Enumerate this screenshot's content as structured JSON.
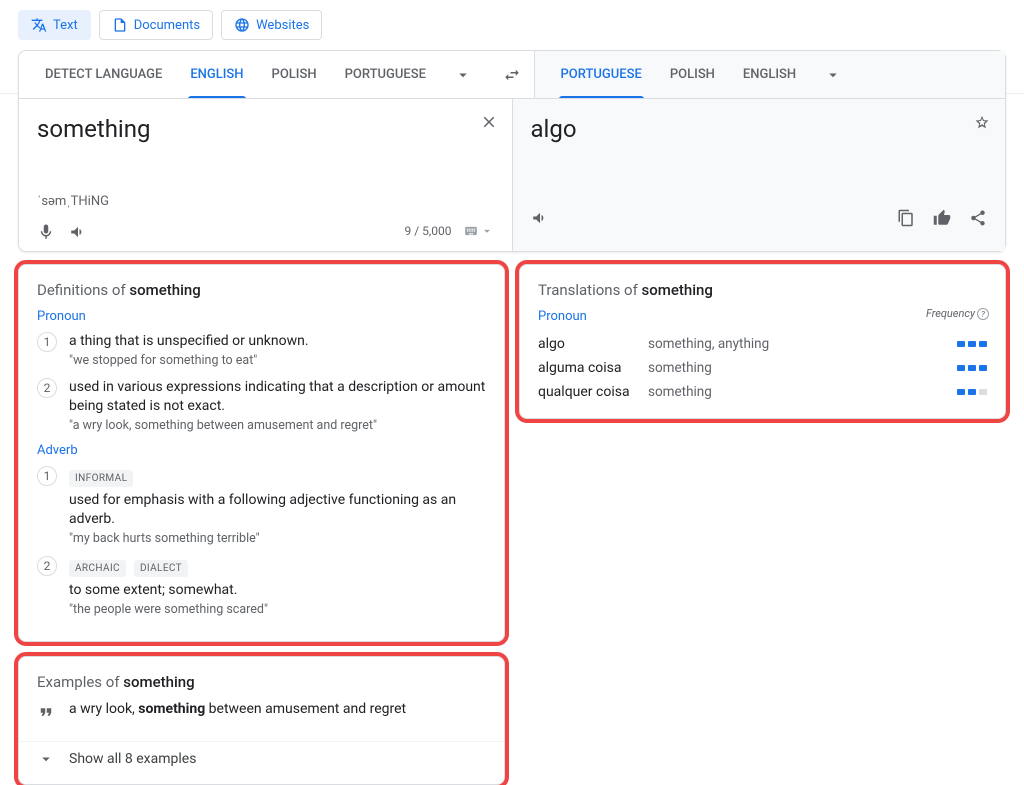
{
  "chips": {
    "text": "Text",
    "documents": "Documents",
    "websites": "Websites"
  },
  "lang": {
    "detect": "DETECT LANGUAGE",
    "src": [
      "ENGLISH",
      "POLISH",
      "PORTUGUESE"
    ],
    "tgt": [
      "PORTUGUESE",
      "POLISH",
      "ENGLISH"
    ]
  },
  "source": {
    "text": "something",
    "phonetic": "ˈsəmˌTHiNG",
    "counter": "9 / 5,000"
  },
  "target": {
    "text": "algo"
  },
  "definitions": {
    "title_prefix": "Definitions of",
    "word": "something",
    "groups": [
      {
        "pos": "Pronoun",
        "items": [
          {
            "num": "1",
            "def": "a thing that is unspecified or unknown.",
            "ex": "\"we stopped for something to eat\"",
            "tags": []
          },
          {
            "num": "2",
            "def": "used in various expressions indicating that a description or amount being stated is not exact.",
            "ex": "\"a wry look, something between amusement and regret\"",
            "tags": []
          }
        ]
      },
      {
        "pos": "Adverb",
        "items": [
          {
            "num": "1",
            "def": "used for emphasis with a following adjective functioning as an adverb.",
            "ex": "\"my back hurts something terrible\"",
            "tags": [
              "INFORMAL"
            ]
          },
          {
            "num": "2",
            "def": "to some extent; somewhat.",
            "ex": "\"the people were something scared\"",
            "tags": [
              "ARCHAIC",
              "DIALECT"
            ]
          }
        ]
      }
    ]
  },
  "examples": {
    "title_prefix": "Examples of",
    "word": "something",
    "item_pre": "a wry look, ",
    "item_bold": "something",
    "item_post": " between amusement and regret",
    "show_all": "Show all 8 examples"
  },
  "translations": {
    "title_prefix": "Translations of",
    "word": "something",
    "freq_label": "Frequency",
    "pos": "Pronoun",
    "rows": [
      {
        "term": "algo",
        "reverse": "something, anything",
        "freq": 3
      },
      {
        "term": "alguma coisa",
        "reverse": "something",
        "freq": 3
      },
      {
        "term": "qualquer coisa",
        "reverse": "something",
        "freq": 2
      }
    ]
  }
}
